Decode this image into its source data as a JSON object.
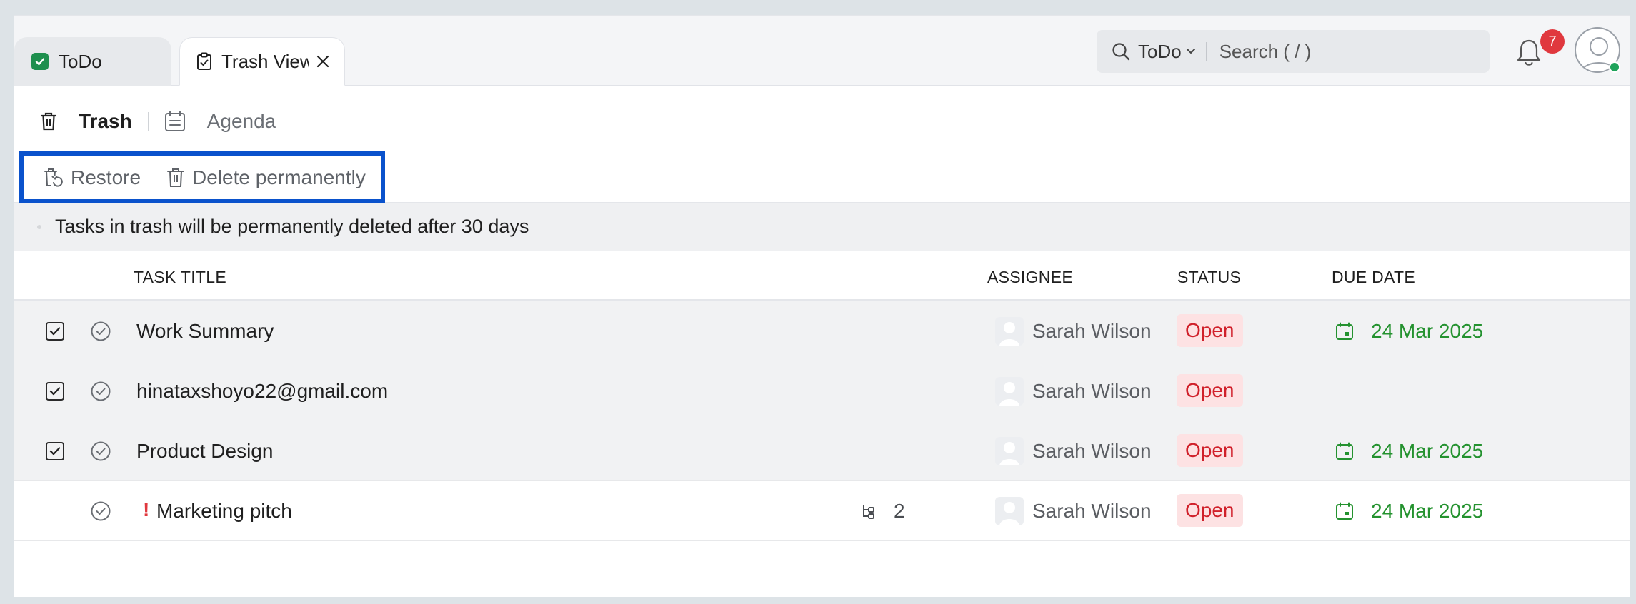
{
  "tabs": [
    {
      "label": "ToDo"
    },
    {
      "label": "Trash View"
    }
  ],
  "search": {
    "scope": "ToDo",
    "placeholder": "Search ( / )"
  },
  "notifications": {
    "count": "7"
  },
  "views": {
    "trash": "Trash",
    "agenda": "Agenda"
  },
  "actions": {
    "restore": "Restore",
    "delete": "Delete permanently"
  },
  "notice": "Tasks in trash will be permanently deleted after 30 days",
  "columns": {
    "title": "TASK TITLE",
    "assignee": "ASSIGNEE",
    "status": "STATUS",
    "due": "DUE DATE"
  },
  "rows": [
    {
      "title": "Work Summary",
      "assignee": "Sarah Wilson",
      "status": "Open",
      "due": "24 Mar 2025",
      "selected": true
    },
    {
      "title": "hinataxshoyo22@gmail.com",
      "assignee": "Sarah Wilson",
      "status": "Open",
      "due": "",
      "selected": true
    },
    {
      "title": "Product Design",
      "assignee": "Sarah Wilson",
      "status": "Open",
      "due": "24 Mar 2025",
      "selected": true
    },
    {
      "title": "Marketing pitch",
      "priority": "!",
      "subtasks": "2",
      "assignee": "Sarah Wilson",
      "status": "Open",
      "due": "24 Mar 2025",
      "selected": false
    }
  ],
  "colors": {
    "accent_blue": "#0a52cc",
    "open_status": "#d0202a",
    "due_green": "#24922f",
    "badge_red": "#e0383e"
  }
}
